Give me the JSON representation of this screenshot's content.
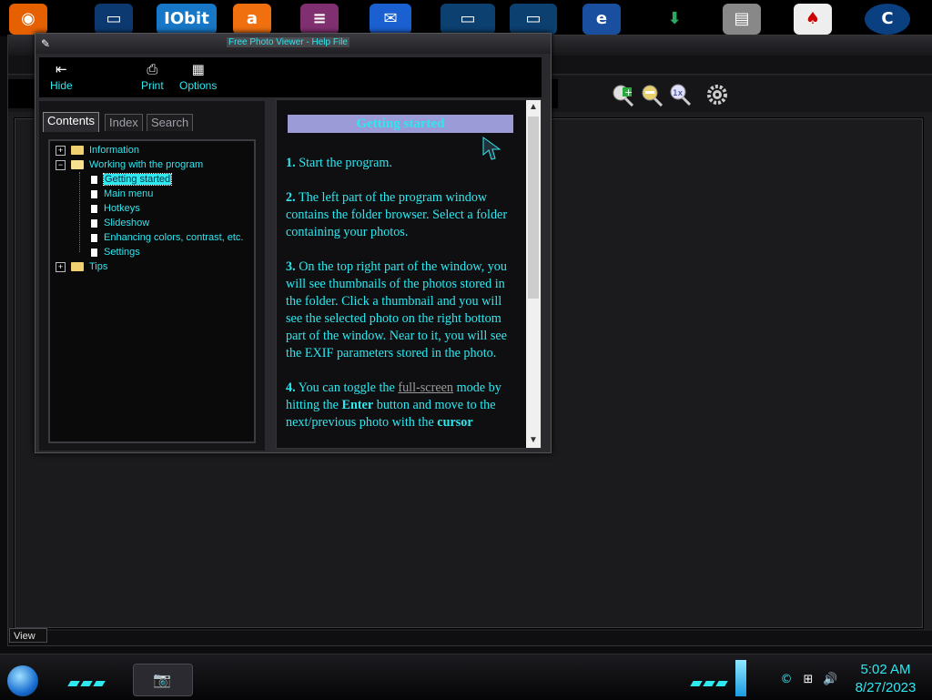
{
  "desktop_icons": [
    {
      "name": "firefox-icon",
      "color": "#e66000"
    },
    {
      "name": "monitor-icon",
      "color": "#1f80c8"
    },
    {
      "name": "iobit-icon",
      "color": "#1878c8",
      "label": "IObit"
    },
    {
      "name": "avast-icon",
      "color": "#f07010"
    },
    {
      "name": "winrar-icon",
      "color": "#8040a0"
    },
    {
      "name": "mail-icon",
      "color": "#1a60d0"
    },
    {
      "name": "network-monitor-icon",
      "color": "#1a90c8"
    },
    {
      "name": "network-monitor-icon-2",
      "color": "#1a90c8"
    },
    {
      "name": "edge-icon",
      "color": "#1a6fd0"
    },
    {
      "name": "download-arrow-icon",
      "color": "#2aa860"
    },
    {
      "name": "disk-cleaner-icon",
      "color": "#c0c0c0"
    },
    {
      "name": "solitaire-icon",
      "color": "#e0e0e0"
    },
    {
      "name": "ccleaner-icon",
      "color": "#1a80c8"
    }
  ],
  "help_window": {
    "title": "Free Photo Viewer - Help File",
    "toolbar": {
      "hide": "Hide",
      "print": "Print",
      "options": "Options"
    },
    "tabs": [
      "Contents",
      "Index",
      "Search"
    ],
    "tree": [
      {
        "label": "Information",
        "type": "folder",
        "expander": "+",
        "level": 0
      },
      {
        "label": "Working with the program",
        "type": "folder-open",
        "expander": "−",
        "level": 0
      },
      {
        "label": "Getting started",
        "type": "page",
        "level": 1,
        "selected": true
      },
      {
        "label": "Main menu",
        "type": "page",
        "level": 1
      },
      {
        "label": "Hotkeys",
        "type": "page",
        "level": 1
      },
      {
        "label": "Slideshow",
        "type": "page",
        "level": 1
      },
      {
        "label": "Enhancing colors, contrast, etc.",
        "type": "page",
        "level": 1
      },
      {
        "label": "Settings",
        "type": "page",
        "level": 1
      },
      {
        "label": "Tips",
        "type": "folder",
        "expander": "+",
        "level": 0
      }
    ],
    "content": {
      "title": "Getting started",
      "p1_num": "1.",
      "p1_text": "Start the program.",
      "p2_num": "2.",
      "p2_text": "The left part of the program window contains the folder browser. Select a folder containing your photos.",
      "p3_num": "3.",
      "p3_text": "On the top right part of the window, you will see thumbnails of the photos stored in the folder. Click a thumbnail and you will see the selected photo on the right bottom part of the window. Near to it, you will see the EXIF parameters stored in the photo.",
      "p4_num": "4.",
      "p4_a": "You can toggle the",
      "p4_link": "full-screen",
      "p4_b": "mode by hitting the",
      "p4_bold1": "Enter",
      "p4_c": "button and move to the next/previous photo with the",
      "p4_bold2": "cursor"
    }
  },
  "background_app": {
    "view_tab": "View",
    "tools": [
      "zoom-in-icon",
      "zoom-out-icon",
      "zoom-1x-icon",
      "settings-gear-icon"
    ]
  },
  "taskbar": {
    "time": "5:02 AM",
    "date": "8/27/2023"
  },
  "colors": {
    "accent": "#2ee8f0",
    "content_title_bg": "#9b9bd8"
  }
}
